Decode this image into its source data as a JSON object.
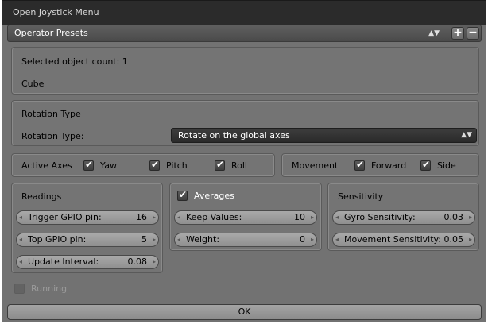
{
  "window": {
    "title": "Open Joystick Menu"
  },
  "presets": {
    "label": "Operator Presets",
    "arrows": "▲▼",
    "add": "+",
    "remove": "−"
  },
  "selection": {
    "count_text": "Selected object count: 1",
    "object_name": "Cube"
  },
  "rotation": {
    "section_title": "Rotation Type",
    "label": "Rotation Type:",
    "value": "Rotate on the global axes",
    "arrows": "▲▼"
  },
  "active_axes": {
    "label": "Active Axes",
    "items": [
      {
        "label": "Yaw",
        "checked": true
      },
      {
        "label": "Pitch",
        "checked": true
      },
      {
        "label": "Roll",
        "checked": true
      }
    ]
  },
  "movement": {
    "label": "Movement",
    "items": [
      {
        "label": "Forward",
        "checked": true
      },
      {
        "label": "Side",
        "checked": true
      }
    ]
  },
  "readings": {
    "title": "Readings",
    "fields": [
      {
        "label": "Trigger GPIO pin:",
        "value": "16"
      },
      {
        "label": "Top GPIO pin:",
        "value": "5"
      },
      {
        "label": "Update Interval:",
        "value": "0.08"
      }
    ]
  },
  "averages": {
    "label": "Averages",
    "checked": true,
    "fields": [
      {
        "label": "Keep Values:",
        "value": "10"
      },
      {
        "label": "Weight:",
        "value": "0"
      }
    ]
  },
  "sensitivity": {
    "title": "Sensitivity",
    "fields": [
      {
        "label": "Gyro Sensitivity:",
        "value": "0.03"
      },
      {
        "label": "Movement Sensitivity:",
        "value": "0.05"
      }
    ]
  },
  "running": {
    "label": "Running",
    "checked": false
  },
  "ok_button": {
    "label": "OK"
  },
  "icons": {
    "check": "✔",
    "left_arrow": "◂",
    "right_arrow": "▸"
  }
}
